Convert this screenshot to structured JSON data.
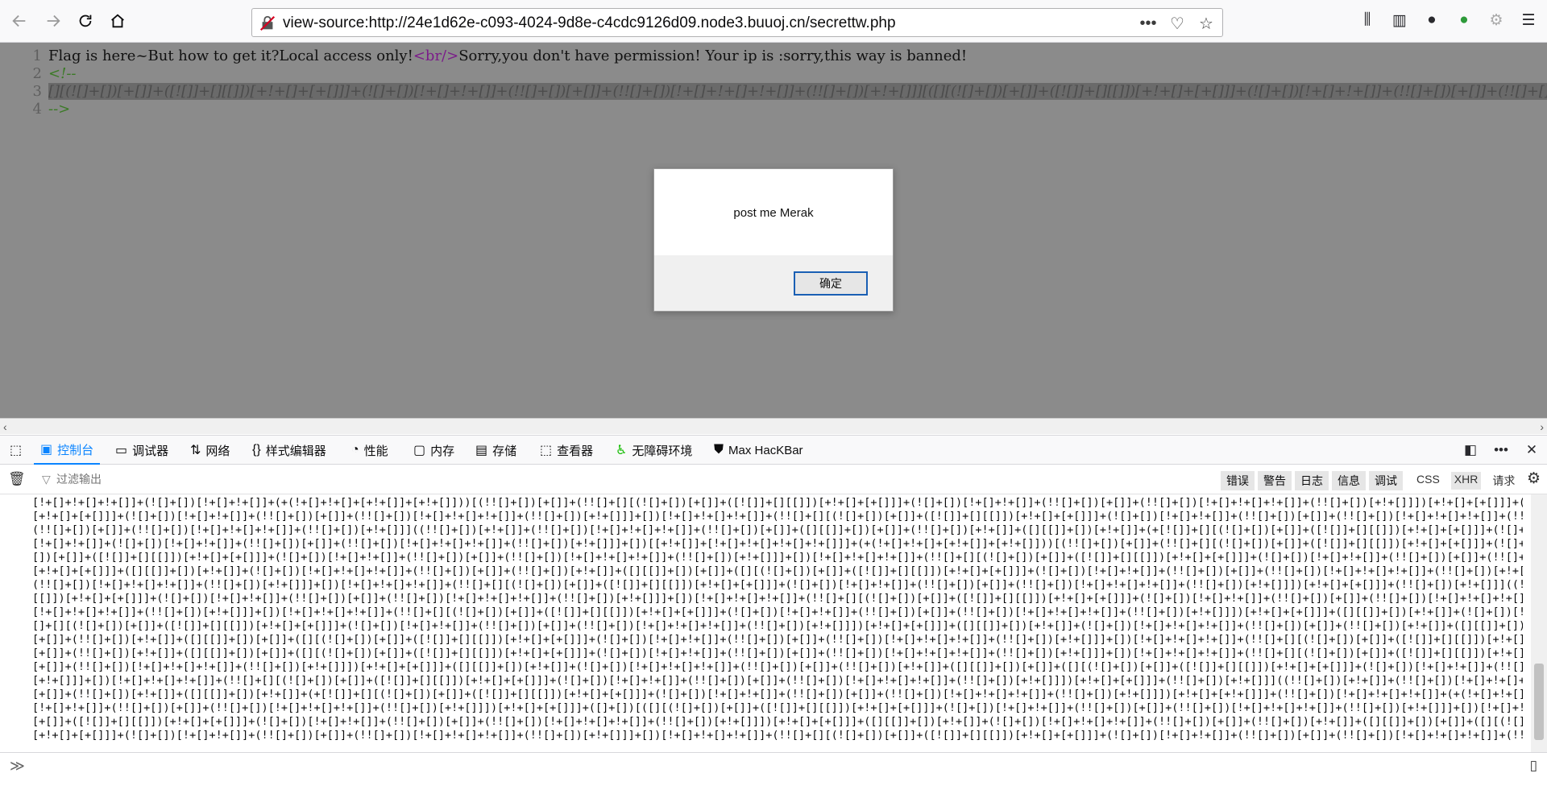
{
  "browser": {
    "url": "view-source:http://24e1d62e-c093-4024-9d8e-c4cdc9126d09.node3.buuoj.cn/secrettw.php"
  },
  "source": {
    "lines": [
      {
        "num": "1",
        "pre": "Flag is here~But how to get it?Local access only!",
        "tag": "<br/>",
        "post": "Sorry,you don't have permission!  Your ip is :sorry,this way is banned!"
      },
      {
        "num": "2",
        "comment": "<!--"
      },
      {
        "num": "3",
        "selected": "[][(![]+[])[+[]]+([![]]+[][[]])[+!+[]+[+[]]]+(![]+[])[!+[]+!+[]]+(!![]+[])[+[]]+(!![]+[])[!+[]+!+[]+!+[]]+(!![]+[])[+!+[]]][([][(![]+[])[+[]]+([![]]+[][[]])[+!+[]+[+[]]]+(![]+[])[!+[]+!+[]]+(!![]+[])[+[]]+(!![]+[])[!+[]+!+[]+!+[]]+(!![]+[])[+!+[]]]+[])[!+[]+!+[]+!+[]]"
      },
      {
        "num": "4",
        "comment": "-->"
      }
    ]
  },
  "dialog": {
    "message": "post me Merak",
    "ok_label": "确定"
  },
  "devtools": {
    "tabs": [
      {
        "label": "控制台",
        "icon": "console-icon"
      },
      {
        "label": "调试器",
        "icon": "debugger-icon"
      },
      {
        "label": "网络",
        "icon": "network-icon"
      },
      {
        "label": "样式编辑器",
        "icon": "style-editor-icon"
      },
      {
        "label": "性能",
        "icon": "performance-icon"
      },
      {
        "label": "内存",
        "icon": "memory-icon"
      },
      {
        "label": "存储",
        "icon": "storage-icon"
      },
      {
        "label": "查看器",
        "icon": "inspector-icon"
      },
      {
        "label": "无障碍环境",
        "icon": "accessibility-icon"
      },
      {
        "label": "Max HacKBar",
        "icon": "hackbar-icon"
      }
    ],
    "filter_placeholder": "过滤输出",
    "levels": [
      "错误",
      "警告",
      "日志",
      "信息",
      "调试"
    ],
    "net_filters": [
      "CSS",
      "XHR",
      "请求"
    ]
  },
  "console": {
    "lines": [
      "[!+[]+!+[]+!+[]]+(![]+[])[!+[]+!+[]]+(+(!+[]+!+[]+[+!+[]]+[+!+[]]))[(!![]+[])[+[]]+(!![]+[][(![]+[])[+[]]+([![]]+[][[]])[+!+[]+[+[]]]+(![]+[])[!+[]+!+[]]+(!![]+[])[+[]]+(!![]+[])[!+[]+!+[]+!+[]]+(!![]+[])[+!+[]]])[+!+[]+[+[]]]+([]+[])[([][(![]+[])[+[]]+([![]]+[][[]])",
      "[+!+[]+[+[]]]+(![]+[])[!+[]+!+[]]+(!![]+[])[+[]]+(!![]+[])[!+[]+!+[]+!+[]]+(!![]+[])[+!+[]]]+[])[!+[]+!+[]+!+[]]+(!![]+[][(![]+[])[+[]]+([![]]+[][[]])[+!+[]+[+[]]]+(![]+[])[!+[]+!+[]]+(!![]+[])[+[]]+(!![]+[])[!+[]+!+[]+!+[]]+(!![]+[])[+!+[]]])[+!+[]+[+[]]]+([][[]]+[])[+!+[]]+(![]+[])",
      "(!![]+[])[+[]]+(!![]+[])[!+[]+!+[]+!+[]]+(!![]+[])[+!+[]]]((!![]+[])[+!+[]]+(!![]+[])[!+[]+!+[]+!+[]]+(!![]+[])[+[]]+([][[]]+[])[+[]]+(!![]+[])[+!+[]]+([][[]]+[])[+!+[]]+(+[![]]+[][(![]+[])[+[]]+([![]]+[][[]])[+!+[]+[+[]]]+(![]+[])[!+[]+!+[]]+(!![]+[])[+[]]",
      "[!+[]+!+[]]+(![]+[])[!+[]+!+[]]+(!![]+[])[+[]]+(!![]+[])[!+[]+!+[]+!+[]]+(!![]+[])[+!+[]]]+[])[[+!+[]]+[!+[]+!+[]+!+[]+!+[]]]+(+(!+[]+!+[]+[+!+[]]+[+!+[]]))[(!![]+[])[+[]]+(!![]+[][(![]+[])[+[]]+([![]]+[][[]])[+!+[]+[+[]]]+(![]+[])[!+[]+!+[]]+(!![]+[])[+[]]+(![]+",
      "[])[+[]]+([![]]+[][[]])[+!+[]+[+[]]]+(![]+[])[!+[]+!+[]]+(!![]+[])[+[]]+(!![]+[])[!+[]+!+[]+!+[]]+(!![]+[])[+!+[]]]+[])[!+[]+!+[]+!+[]]+(!![]+[][(![]+[])[+[]]+([![]]+[][[]])[+!+[]+[+[]]]+(![]+[])[!+[]+!+[]]+(!![]+[])[+[]]+(!![]+[])[!+[]+!+[]+!+[]]+(!![]+[])[+!+[]]])",
      "[+!+[]+[+[]]]+([][[]]+[])[+!+[]]+(![]+[])[!+[]+!+[]+!+[]]+(!![]+[])[+[]]+(!![]+[])[+!+[]]+([][[]]+[])[+[]]+([][(![]+[])[+[]]+([![]]+[][[]])[+!+[]+[+[]]]+(![]+[])[!+[]+!+[]]+(!![]+[])[+[]]+(!![]+[])[!+[]+!+[]+!+[]]+(!![]+[])[+!+[]]]+[])[!+[]+!+[]+!+[]]+(!![]+",
      "(!![]+[])[!+[]+!+[]+!+[]]+(!![]+[])[+!+[]]]+[])[!+[]+!+[]+!+[]]+(!![]+[][(![]+[])[+[]]+([![]]+[][[]])[+!+[]+[+[]]]+(![]+[])[!+[]+!+[]]+(!![]+[])[+[]]+(!![]+[])[!+[]+!+[]+!+[]]+(!![]+[])[+!+[]]])[+!+[]+[+[]]]+(!![]+[])[+!+[]]]((!![]+[])[+!+[]]+(!![]+[])[!+[]+!+[]+!+[]]",
      "[[]])[+!+[]+[+[]]]+(![]+[])[!+[]+!+[]]+(!![]+[])[+[]]+(!![]+[])[!+[]+!+[]+!+[]]+(!![]+[])[+!+[]]]+[])[!+[]+!+[]+!+[]]+(!![]+[][(![]+[])[+[]]+([![]]+[][[]])[+!+[]+[+[]]]+(![]+[])[!+[]+!+[]]+(!![]+[])[+[]]+(!![]+[])[!+[]+!+[]+!+[]]+(!![]+[])[+!+[]]])[+!+[]+[+[]]]",
      "[!+[]+!+[]+!+[]]+(!![]+[])[+!+[]]]+[])[!+[]+!+[]+!+[]]+(!![]+[][(![]+[])[+[]]+([![]]+[][[]])[+!+[]+[+[]]]+(![]+[])[!+[]+!+[]]+(!![]+[])[+[]]+(!![]+[])[!+[]+!+[]+!+[]]+(!![]+[])[+!+[]]])[+!+[]+[+[]]]+([][[]]+[])[+!+[]]+(![]+[])[!+[]+!+[]+!+[]]+(!![]+[])[+[]]+",
      "[]+[][(![]+[])[+[]]+([![]]+[][[]])[+!+[]+[+[]]]+(![]+[])[!+[]+!+[]]+(!![]+[])[+[]]+(!![]+[])[!+[]+!+[]+!+[]]+(!![]+[])[+!+[]]])[+!+[]+[+[]]]+([][[]]+[])[+!+[]]+(![]+[])[!+[]+!+[]+!+[]]+(!![]+[])[+[]]+(!![]+[])[+!+[]]+([][[]]+[])[+[]]+([][(![]+[])[+[]]+([![]]",
      "[+[]]+(!![]+[])[+!+[]]+([][[]]+[])[+[]]+([][(![]+[])[+[]]+([![]]+[][[]])[+!+[]+[+[]]]+(![]+[])[!+[]+!+[]]+(!![]+[])[+[]]+(!![]+[])[!+[]+!+[]+!+[]]+(!![]+[])[+!+[]]]+[])[!+[]+!+[]+!+[]]+(!![]+[][(![]+[])[+[]]+([![]]+[][[]])[+!+[]+[+[]]]+(![]+[])[!+[]+!+[]]+",
      "[+[]]+(!![]+[])[+!+[]]+([][[]]+[])[+[]]+([][(![]+[])[+[]]+([![]]+[][[]])[+!+[]+[+[]]]+(![]+[])[!+[]+!+[]]+(!![]+[])[+[]]+(!![]+[])[!+[]+!+[]+!+[]]+(!![]+[])[+!+[]]]+[])[!+[]+!+[]+!+[]]+(!![]+[][(![]+[])[+[]]+([![]]+[][[]])[+!+[]+[+[]]]+(![]+[])[!+[]+!+[]]+(!![]+[])",
      "[+[]]+(!![]+[])[!+[]+!+[]+!+[]]+(!![]+[])[+!+[]]])[+!+[]+[+[]]]+([][[]]+[])[+!+[]]+(![]+[])[!+[]+!+[]+!+[]]+(!![]+[])[+[]]+(!![]+[])[+!+[]]+([][[]]+[])[+[]]+([][(![]+[])[+[]]+([![]]+[][[]])[+!+[]+[+[]]]+(![]+[])[!+[]+!+[]]+(!![]+[])[+[]]+(!![]+[])[!+[]+!+[]+!+[]]",
      "[+!+[]]]+[])[!+[]+!+[]+!+[]]+(!![]+[][(![]+[])[+[]]+([![]]+[][[]])[+!+[]+[+[]]]+(![]+[])[!+[]+!+[]]+(!![]+[])[+[]]+(!![]+[])[!+[]+!+[]+!+[]]+(!![]+[])[+!+[]]])[+!+[]+[+[]]]+(!![]+[])[+!+[]]]((!![]+[])[+!+[]]+(!![]+[])[!+[]+!+[]+!+[]]+(!![]+[])[+[]]+([][[]]+[])",
      "[+[]]+(!![]+[])[+!+[]]+([][[]]+[])[+!+[]]+(+[![]]+[][(![]+[])[+[]]+([![]]+[][[]])[+!+[]+[+[]]]+(![]+[])[!+[]+!+[]]+(!![]+[])[+[]]+(!![]+[])[!+[]+!+[]+!+[]]+(!![]+[])[+!+[]]])[+!+[]+[+!+[]]]+(!![]+[])[!+[]+!+[]+!+[]]+(+(!+[]+!+[]+!+[]+[+!+[]]))[(!![]+[])[+[]]+",
      "[!+[]+!+[]]+(!![]+[])[+[]]+(!![]+[])[!+[]+!+[]+!+[]]+(!![]+[])[+!+[]]])[+!+[]+[+[]]]+([]+[])[([][(![]+[])[+[]]+([![]]+[][[]])[+!+[]+[+[]]]+(![]+[])[!+[]+!+[]]+(!![]+[])[+[]]+(!![]+[])[!+[]+!+[]+!+[]]+(!![]+[])[+!+[]]]+[])[!+[]+!+[]+!+[]]+(!![]+[][(![]+[])",
      "[+[]]+([![]]+[][[]])[+!+[]+[+[]]]+(![]+[])[!+[]+!+[]]+(!![]+[])[+[]]+(!![]+[])[!+[]+!+[]+!+[]]+(!![]+[])[+!+[]]])[+!+[]+[+[]]]+([][[]]+[])[+!+[]]+(![]+[])[!+[]+!+[]+!+[]]+(!![]+[])[+[]]+(!![]+[])[+!+[]]+([][[]]+[])[+[]]+([][(![]+[])[+[]]+([![]]+[][[]])",
      "[+!+[]+[+[]]]+(![]+[])[!+[]+!+[]]+(!![]+[])[+[]]+(!![]+[])[!+[]+!+[]+!+[]]+(!![]+[])[+!+[]]]+[])[!+[]+!+[]+!+[]]+(!![]+[][(![]+[])[+[]]+([![]]+[][[]])[+!+[]+[+[]]]+(![]+[])[!+[]+!+[]]+(!![]+[])[+[]]+(!![]+[])[!+[]+!+[]+!+[]]+(!![]+[])[+!+[]]])[+!+[]+[+[]]]+(!!"
    ]
  }
}
